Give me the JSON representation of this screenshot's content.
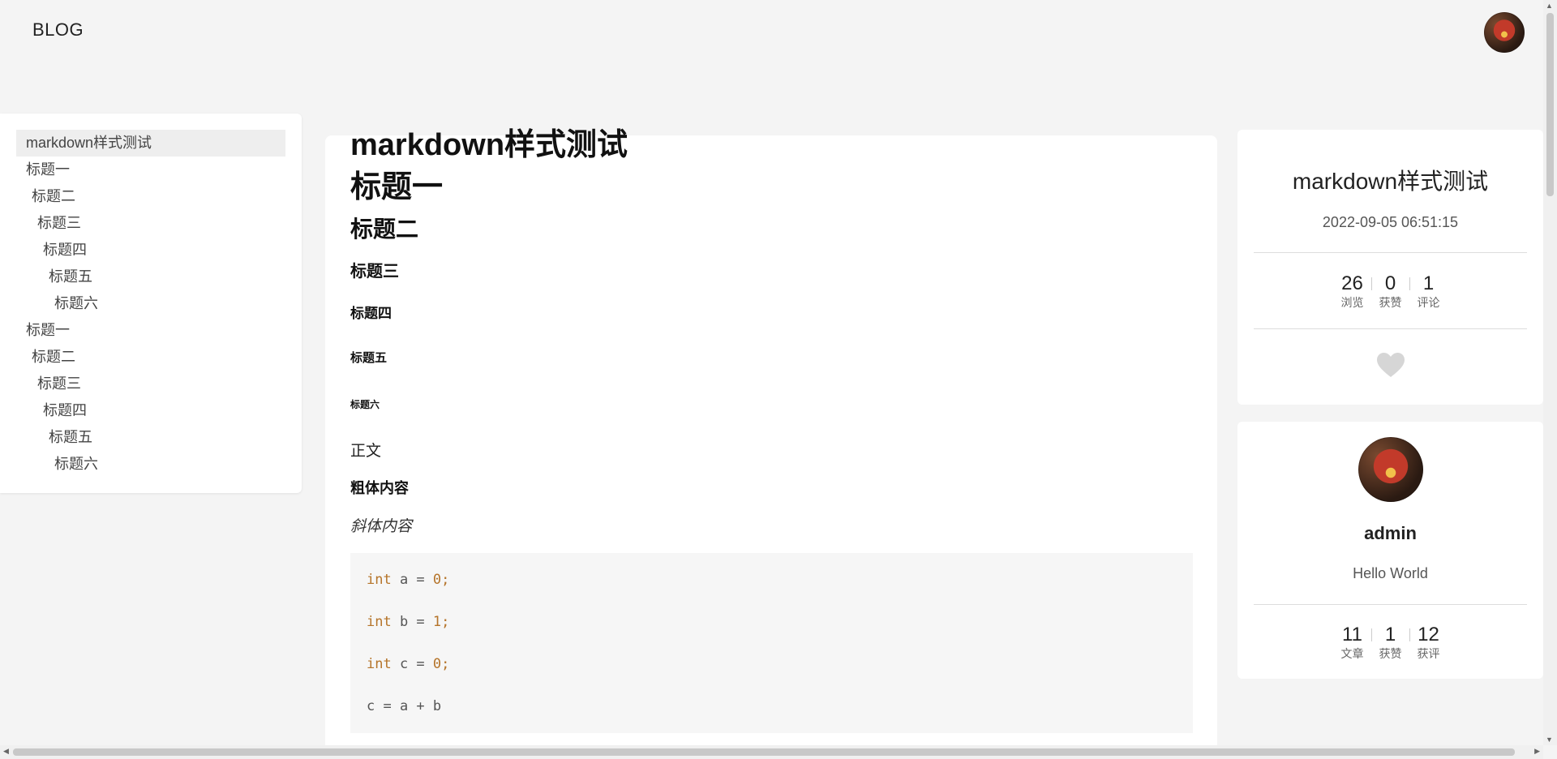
{
  "header": {
    "brand": "BLOG"
  },
  "toc": {
    "items": [
      {
        "label": "markdown样式测试",
        "level": 0,
        "active": true
      },
      {
        "label": "标题一",
        "level": 1
      },
      {
        "label": "标题二",
        "level": 2
      },
      {
        "label": "标题三",
        "level": 3
      },
      {
        "label": "标题四",
        "level": 4
      },
      {
        "label": "标题五",
        "level": 5
      },
      {
        "label": "标题六",
        "level": 6
      },
      {
        "label": "标题一",
        "level": 1
      },
      {
        "label": "标题二",
        "level": 2
      },
      {
        "label": "标题三",
        "level": 3
      },
      {
        "label": "标题四",
        "level": 4
      },
      {
        "label": "标题五",
        "level": 5
      },
      {
        "label": "标题六",
        "level": 6
      }
    ]
  },
  "article": {
    "title": "markdown样式测试",
    "h1": "标题一",
    "h2": "标题二",
    "h3": "标题三",
    "h4": "标题四",
    "h5": "标题五",
    "h6": "标题六",
    "normal": "正文",
    "bold": "粗体内容",
    "italic": "斜体内容",
    "code": {
      "lines": [
        [
          {
            "t": "int",
            "c": "kw"
          },
          {
            "t": " a = "
          },
          {
            "t": "0",
            "c": "num"
          },
          {
            "t": ";",
            "c": "kw"
          }
        ],
        [
          {
            "t": "int",
            "c": "kw"
          },
          {
            "t": " b = "
          },
          {
            "t": "1",
            "c": "num"
          },
          {
            "t": ";",
            "c": "kw"
          }
        ],
        [
          {
            "t": "int",
            "c": "kw"
          },
          {
            "t": " c = "
          },
          {
            "t": "0",
            "c": "num"
          },
          {
            "t": ";",
            "c": "kw"
          }
        ],
        [
          {
            "t": "c = a + b"
          }
        ]
      ]
    }
  },
  "info": {
    "title": "markdown样式测试",
    "date": "2022-09-05 06:51:15",
    "stats": [
      {
        "value": "26",
        "label": "浏览"
      },
      {
        "value": "0",
        "label": "获赞"
      },
      {
        "value": "1",
        "label": "评论"
      }
    ],
    "like_icon": "heart-icon"
  },
  "author": {
    "name": "admin",
    "bio": "Hello World",
    "stats": [
      {
        "value": "11",
        "label": "文章"
      },
      {
        "value": "1",
        "label": "获赞"
      },
      {
        "value": "12",
        "label": "获评"
      }
    ]
  },
  "colors": {
    "background": "#f4f4f4",
    "code_keyword": "#b5742a",
    "heart": "#d6d6d6"
  }
}
